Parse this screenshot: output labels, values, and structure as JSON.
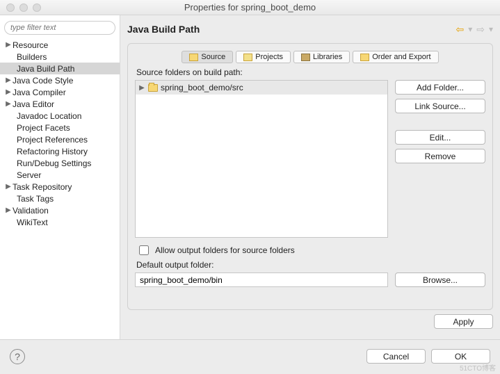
{
  "window": {
    "title": "Properties for spring_boot_demo"
  },
  "filter": {
    "placeholder": "type filter text"
  },
  "tree": [
    {
      "label": "Resource",
      "expandable": true,
      "indent": false
    },
    {
      "label": "Builders",
      "expandable": false,
      "indent": true
    },
    {
      "label": "Java Build Path",
      "expandable": false,
      "indent": true,
      "selected": true
    },
    {
      "label": "Java Code Style",
      "expandable": true,
      "indent": false
    },
    {
      "label": "Java Compiler",
      "expandable": true,
      "indent": false
    },
    {
      "label": "Java Editor",
      "expandable": true,
      "indent": false
    },
    {
      "label": "Javadoc Location",
      "expandable": false,
      "indent": true
    },
    {
      "label": "Project Facets",
      "expandable": false,
      "indent": true
    },
    {
      "label": "Project References",
      "expandable": false,
      "indent": true
    },
    {
      "label": "Refactoring History",
      "expandable": false,
      "indent": true
    },
    {
      "label": "Run/Debug Settings",
      "expandable": false,
      "indent": true
    },
    {
      "label": "Server",
      "expandable": false,
      "indent": true
    },
    {
      "label": "Task Repository",
      "expandable": true,
      "indent": false
    },
    {
      "label": "Task Tags",
      "expandable": false,
      "indent": true
    },
    {
      "label": "Validation",
      "expandable": true,
      "indent": false
    },
    {
      "label": "WikiText",
      "expandable": false,
      "indent": true
    }
  ],
  "page": {
    "title": "Java Build Path"
  },
  "tabs": {
    "source": "Source",
    "projects": "Projects",
    "libraries": "Libraries",
    "order": "Order and Export"
  },
  "source": {
    "label": "Source folders on build path:",
    "items": [
      {
        "path": "spring_boot_demo/src"
      }
    ]
  },
  "buttons": {
    "add_folder": "Add Folder...",
    "link_source": "Link Source...",
    "edit": "Edit...",
    "remove": "Remove",
    "browse": "Browse...",
    "apply": "Apply",
    "cancel": "Cancel",
    "ok": "OK"
  },
  "allow_output": {
    "label": "Allow output folders for source folders"
  },
  "default_output": {
    "label": "Default output folder:",
    "value": "spring_boot_demo/bin"
  },
  "watermark": "51CTO博客"
}
